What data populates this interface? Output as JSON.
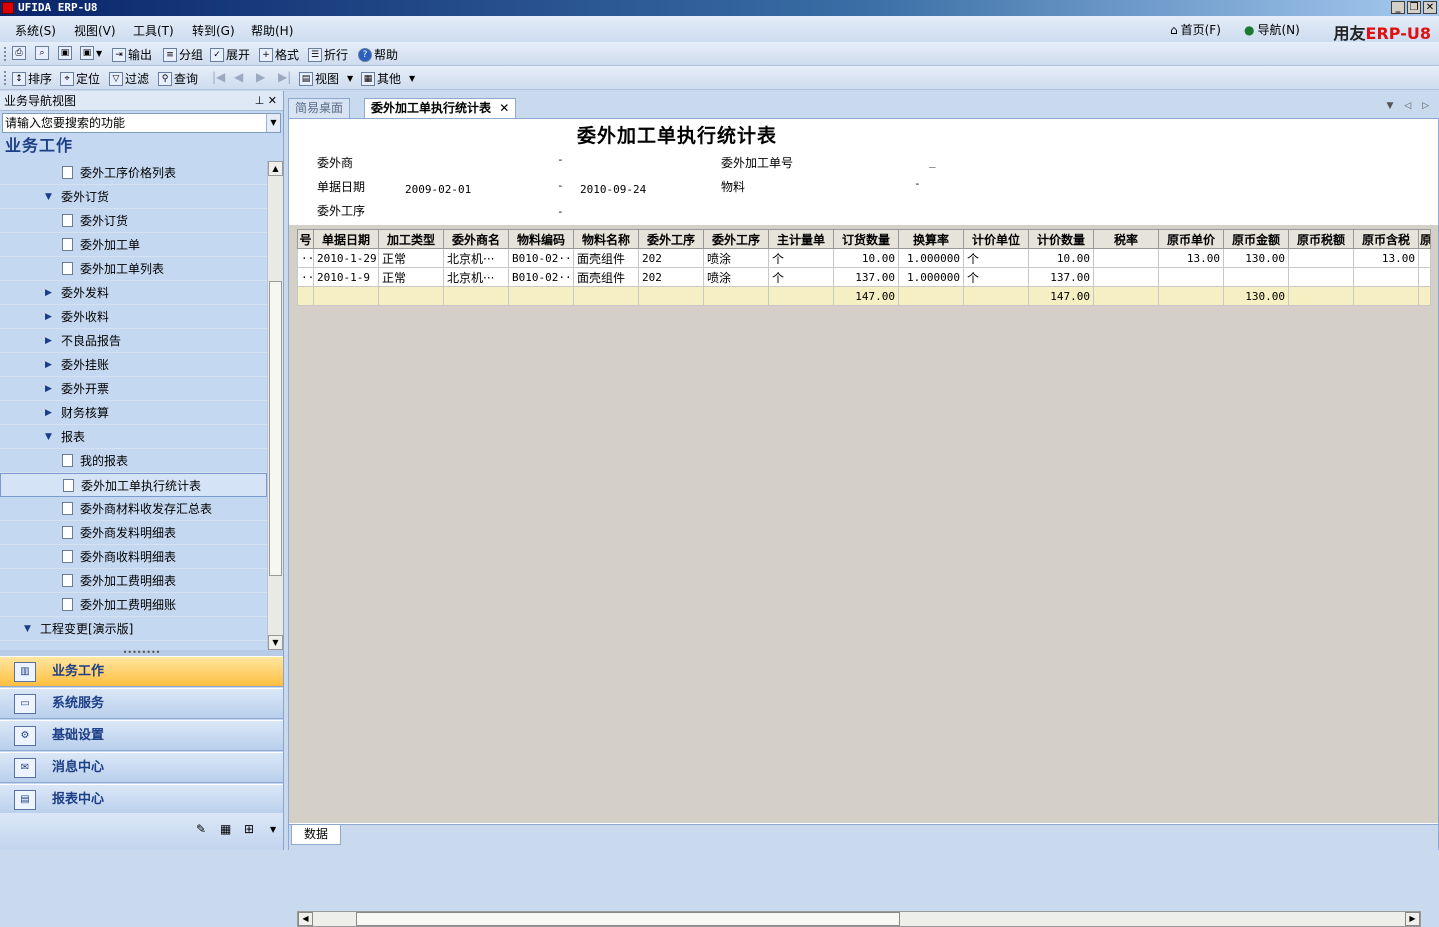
{
  "app": {
    "title": "UFIDA ERP-U8"
  },
  "menubar": {
    "items": [
      "系统(S)",
      "视图(V)",
      "工具(T)",
      "转到(G)",
      "帮助(H)"
    ],
    "home": "首页(F)",
    "nav": "导航(N)",
    "brand_cn": "用友",
    "brand_erp": "ERP-",
    "brand_ver": "U8"
  },
  "toolbar1": {
    "output": "输出",
    "group": "分组",
    "expand": "展开",
    "format": "格式",
    "wrap": "折行",
    "help": "帮助"
  },
  "toolbar2": {
    "sort": "排序",
    "locate": "定位",
    "filter": "过滤",
    "query": "查询",
    "view": "视图",
    "other": "其他"
  },
  "leftpanel": {
    "title": "业务导航视图",
    "search_placeholder": "请输入您要搜索的功能",
    "section": "业务工作",
    "tree": [
      {
        "label": "委外工序价格列表",
        "level": 2,
        "kind": "doc"
      },
      {
        "label": "委外订货",
        "level": 1,
        "kind": "open"
      },
      {
        "label": "委外订货",
        "level": 2,
        "kind": "doc"
      },
      {
        "label": "委外加工单",
        "level": 2,
        "kind": "doc"
      },
      {
        "label": "委外加工单列表",
        "level": 2,
        "kind": "doc"
      },
      {
        "label": "委外发料",
        "level": 1,
        "kind": "closed"
      },
      {
        "label": "委外收料",
        "level": 1,
        "kind": "closed"
      },
      {
        "label": "不良品报告",
        "level": 1,
        "kind": "closed"
      },
      {
        "label": "委外挂账",
        "level": 1,
        "kind": "closed"
      },
      {
        "label": "委外开票",
        "level": 1,
        "kind": "closed"
      },
      {
        "label": "财务核算",
        "level": 1,
        "kind": "closed"
      },
      {
        "label": "报表",
        "level": 1,
        "kind": "open"
      },
      {
        "label": "我的报表",
        "level": 2,
        "kind": "doc"
      },
      {
        "label": "委外加工单执行统计表",
        "level": 2,
        "kind": "doc",
        "selected": true
      },
      {
        "label": "委外商材料收发存汇总表",
        "level": 2,
        "kind": "doc"
      },
      {
        "label": "委外商发料明细表",
        "level": 2,
        "kind": "doc"
      },
      {
        "label": "委外商收料明细表",
        "level": 2,
        "kind": "doc"
      },
      {
        "label": "委外加工费明细表",
        "level": 2,
        "kind": "doc"
      },
      {
        "label": "委外加工费明细账",
        "level": 2,
        "kind": "doc"
      },
      {
        "label": "工程变更[演示版]",
        "level": 0,
        "kind": "open"
      }
    ],
    "nav_buttons": [
      "业务工作",
      "系统服务",
      "基础设置",
      "消息中心",
      "报表中心"
    ]
  },
  "tabs": [
    {
      "label": "简易桌面",
      "active": false
    },
    {
      "label": "委外加工单执行统计表",
      "active": true
    }
  ],
  "report": {
    "title": "委外加工单执行统计表",
    "f_vendor": "委外商",
    "f_orderno": "委外加工单号",
    "f_date": "单据日期",
    "date_from": "2009-02-01",
    "date_to": "2010-09-24",
    "f_material": "物料",
    "f_process": "委外工序",
    "dash": "-",
    "underscore": "_",
    "columns": [
      "号",
      "单据日期",
      "加工类型",
      "委外商名",
      "物料编码",
      "物料名称",
      "委外工序",
      "委外工序",
      "主计量单",
      "订货数量",
      "换算率",
      "计价单位",
      "计价数量",
      "税率",
      "原币单价",
      "原币金额",
      "原币税额",
      "原币含税",
      "原"
    ],
    "rows": [
      [
        "···",
        "2010-1-29",
        "正常",
        "北京机···",
        "B010-02···",
        "面壳组件",
        "202",
        "喷涂",
        "个",
        "10.00",
        "1.000000",
        "个",
        "10.00",
        "",
        "13.00",
        "130.00",
        "",
        "13.00",
        ""
      ],
      [
        "···",
        "2010-1-9",
        "正常",
        "北京机···",
        "B010-02···",
        "面壳组件",
        "202",
        "喷涂",
        "个",
        "137.00",
        "1.000000",
        "个",
        "137.00",
        "",
        "",
        "",
        "",
        "",
        ""
      ]
    ],
    "total": [
      "",
      "",
      "",
      "",
      "",
      "",
      "",
      "",
      "",
      "147.00",
      "",
      "",
      "147.00",
      "",
      "",
      "130.00",
      "",
      "",
      ""
    ],
    "sheet_tab": "数据"
  }
}
